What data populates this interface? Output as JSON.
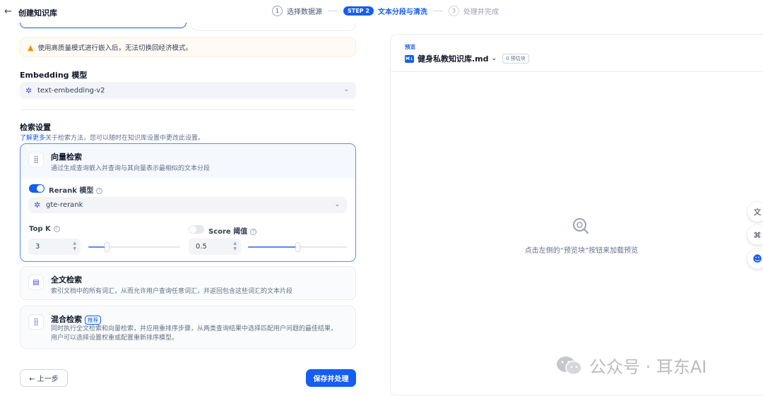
{
  "header": {
    "title": "创建知识库",
    "steps": [
      {
        "num": "1",
        "label": "选择数据源"
      },
      {
        "num": "STEP 2",
        "label": "文本分段与清洗"
      },
      {
        "num": "3",
        "label": "处理并完成"
      }
    ]
  },
  "warning": {
    "text": "使用高质量模式进行嵌入后，无法切换回经济模式。"
  },
  "embedding": {
    "title": "Embedding 模型",
    "value": "text-embedding-v2"
  },
  "retrieval": {
    "title": "检索设置",
    "learn_more": "了解更多",
    "description": "关于检索方法，您可以随时在知识库设置中更改此设置。",
    "vector": {
      "title": "向量检索",
      "description": "通过生成查询嵌入并查询与其向量表示最相似的文本分段",
      "rerank_label": "Rerank 模型",
      "rerank_enabled": true,
      "rerank_model": "gte-rerank",
      "topk_label": "Top K",
      "topk_value": "3",
      "topk_slider_fraction": 0.2,
      "score_label": "Score 阈值",
      "score_enabled": false,
      "score_value": "0.5",
      "score_slider_fraction": 0.5
    },
    "fulltext": {
      "title": "全文检索",
      "description": "索引文档中的所有词汇，从而允许用户查询任意词汇，并返回包含这些词汇的文本片段"
    },
    "hybrid": {
      "title": "混合检索",
      "badge": "推荐",
      "description_line1": "同时执行全文检索和向量检索，并应用重排序步骤，从两类查询结果中选择匹配用户问题的最佳结果，",
      "description_line2": "用户可以选择设置权重或配置重新排序模型。"
    }
  },
  "buttons": {
    "prev": "← 上一步",
    "save": "保存并处理"
  },
  "preview": {
    "label": "预览",
    "file_name": "健身私教知识库.md",
    "chunk_badge": "0 预估块",
    "empty_text": "点击左侧的“预览块”按钮来加载预览"
  },
  "watermark": {
    "text": "公众号 · 耳东AI"
  },
  "icons": {
    "back": "arrow-left-icon",
    "warning": "warning-triangle-icon",
    "model": "model-logo-icon",
    "vector": "grid-dots-icon",
    "fulltext": "document-search-icon",
    "hybrid": "grid-dots-icon",
    "preview_empty": "search-icon",
    "side": [
      "translate-icon",
      "command-icon",
      "bot-icon"
    ]
  },
  "colors": {
    "accent": "#155eef",
    "warning": "#f79009"
  }
}
